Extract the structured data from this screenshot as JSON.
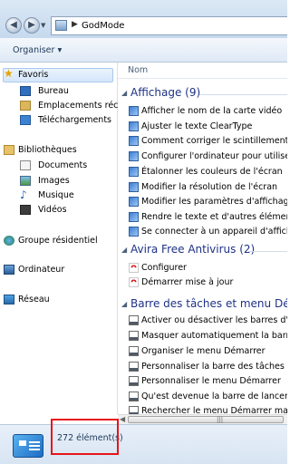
{
  "address_bar": {
    "back": "◀",
    "forward": "▶",
    "path_separator": "▶",
    "path": "GodMode"
  },
  "toolbar": {
    "organize_label": "Organiser ▾"
  },
  "nav": {
    "favorites": "Favoris",
    "favorites_items": [
      "Bureau",
      "Emplacements récents",
      "Téléchargements"
    ],
    "libraries": "Bibliothèques",
    "libraries_items": [
      "Documents",
      "Images",
      "Musique",
      "Vidéos"
    ],
    "homegroup": "Groupe résidentiel",
    "computer": "Ordinateur",
    "network": "Réseau"
  },
  "content": {
    "column_header": "Nom",
    "groups": [
      {
        "title": "Affichage (9)",
        "icon": "display-settings-icon",
        "items": [
          "Afficher le nom de la carte vidéo",
          "Ajuster le texte ClearType",
          "Comment corriger le scintillement du m",
          "Configurer l'ordinateur pour utiliser plu",
          "Étalonner les couleurs de l'écran",
          "Modifier la résolution de l'écran",
          "Modifier les paramètres d'affichage",
          "Rendre le texte et d'autres éléments plu",
          "Se connecter à un appareil d'affichage"
        ]
      },
      {
        "title": "Avira Free Antivirus (2)",
        "icon": "avira-umbrella-icon",
        "items": [
          "Configurer",
          "Démarrer mise à jour"
        ]
      },
      {
        "title": "Barre des tâches et menu Démarrer",
        "icon": "taskbar-icon",
        "items": [
          "Activer ou désactiver les barres d'outils",
          "Masquer automatiquement la barre des",
          "Organiser le menu Démarrer",
          "Personnaliser la barre des tâches",
          "Personnaliser le menu Démarrer",
          "Qu'est devenue la barre de lancement r",
          "Rechercher le menu Démarrer manqua"
        ]
      }
    ]
  },
  "status": {
    "count": "272 élément(s)"
  },
  "colors": {
    "group_title": "#1e3287",
    "highlight": "#e8141a"
  }
}
